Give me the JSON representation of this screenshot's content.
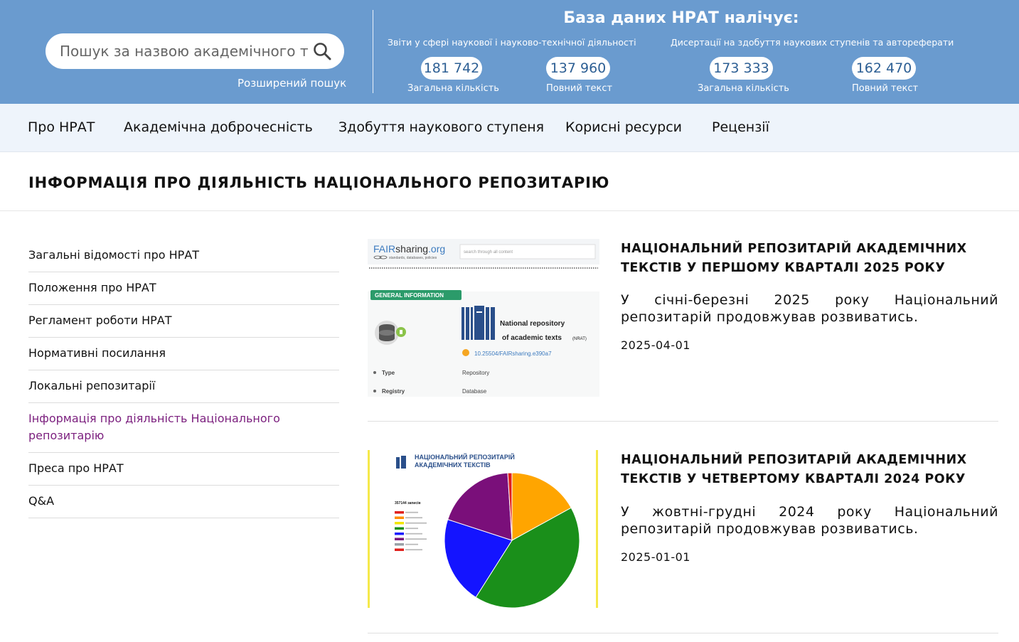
{
  "header": {
    "search": {
      "placeholder": "Пошук за назвою академічного тексту"
    },
    "advanced_search": "Розширений пошук",
    "db_title": "База даних НРАТ налічує:",
    "groups": [
      {
        "title": "Звіти у сфері наукової і науково-технічної діяльності",
        "stats": [
          {
            "value": "181 742",
            "caption": "Загальна кількість"
          },
          {
            "value": "137 960",
            "caption": "Повний текст"
          }
        ]
      },
      {
        "title": "Дисертації на здобуття наукових ступенів та автореферати",
        "stats": [
          {
            "value": "173 333",
            "caption": "Загальна кількість"
          },
          {
            "value": "162 470",
            "caption": "Повний текст"
          }
        ]
      }
    ]
  },
  "nav": {
    "items": [
      "Про НРАТ",
      "Академічна доброчесність",
      "Здобуття наукового ступеня",
      "Корисні ресурси",
      "Рецензії"
    ]
  },
  "page": {
    "title": "ІНФОРМАЦІЯ ПРО ДІЯЛЬНІСТЬ НАЦІОНАЛЬНОГО РЕПОЗИТАРІЮ"
  },
  "sidebar": {
    "items": [
      "Загальні відомості про НРАТ",
      "Положення про НРАТ",
      "Регламент роботи НРАТ",
      "Нормативні посилання",
      "Локальні репозитарії",
      "Інформація про діяльність Національного репозитарію",
      "Преса про НРАТ",
      "Q&A"
    ],
    "active_index": 5,
    "active_color": "#7b1f7e"
  },
  "articles": [
    {
      "title": "НАЦІОНАЛЬНИЙ РЕПОЗИТАРІЙ АКАДЕМІЧНИХ ТЕКСТІВ У ПЕРШОМУ КВАРТАЛІ 2025 РОКУ",
      "desc": "У січні-березні 2025 року Національний репозитарій продовжував розвиватись.",
      "date": "2025-04-01",
      "image": {
        "brand_fair": "FAIR",
        "brand_sharing": "sharing",
        "brand_org": ".org",
        "tagline": "standards, databases, policies",
        "search_placeholder": "search through all content",
        "badge": "GENERAL INFORMATION",
        "repo_name_1": "National repository",
        "repo_name_2": "of academic texts",
        "repo_abbr": "(NRAT)",
        "doi": "10.25504/FAIRsharing.e390a7",
        "row1_label": "Type",
        "row1_value": "Repository",
        "row2_label": "Registry",
        "row2_value": "Database"
      }
    },
    {
      "title": "НАЦІОНАЛЬНИЙ РЕПОЗИТАРІЙ АКАДЕМІЧНИХ ТЕКСТІВ У ЧЕТВЕРТОМУ КВАРТАЛІ 2024 РОКУ",
      "desc": "У жовтні-грудні 2024 року Національний репозитарій продовжував розвиватись.",
      "date": "2025-01-01",
      "image": {
        "logo_line1": "НАЦІОНАЛЬНИЙ РЕПОЗИТАРІЙ",
        "logo_line2": "АКАДЕМІЧНИХ ТЕКСТІВ",
        "legend_total": "357144 записів",
        "legend_colors": [
          "#e0201c",
          "#ff8c00",
          "#f2e600",
          "#1a8f1a",
          "#1a1aff",
          "#7a0f7a",
          "#9aa0a6",
          "#e0201c"
        ],
        "slices": [
          {
            "value": 17,
            "color": "#ffa500"
          },
          {
            "value": 42,
            "color": "#1a8f1a"
          },
          {
            "value": 21,
            "color": "#1414ff"
          },
          {
            "value": 19,
            "color": "#7a0f7a"
          },
          {
            "value": 1,
            "color": "#e0201c"
          }
        ]
      }
    }
  ]
}
